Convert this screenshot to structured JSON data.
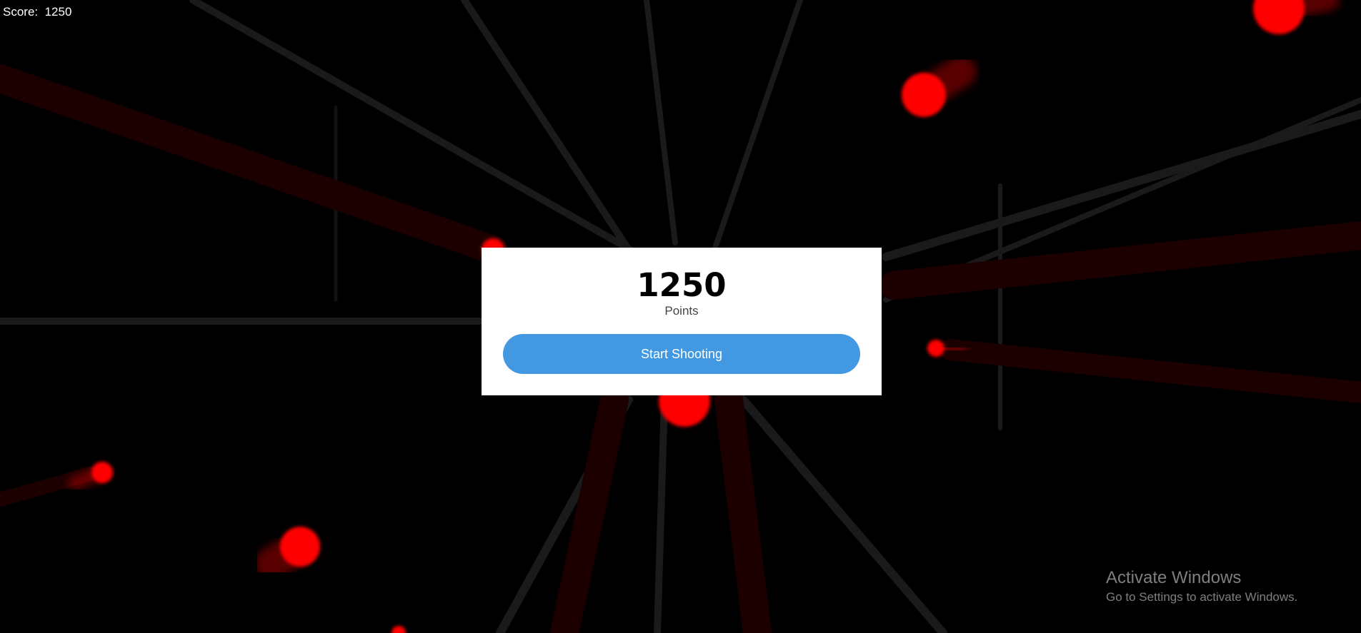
{
  "hud": {
    "score_label": "Score:",
    "score_value": "1250"
  },
  "dialog": {
    "points": "1250",
    "points_caption": "Points",
    "start_button_label": "Start Shooting"
  },
  "watermark": {
    "title": "Activate Windows",
    "subtitle": "Go to Settings to activate Windows."
  },
  "colors": {
    "background": "#000000",
    "target": "#ff0000",
    "button": "#4299e1",
    "dialog": "#ffffff"
  }
}
